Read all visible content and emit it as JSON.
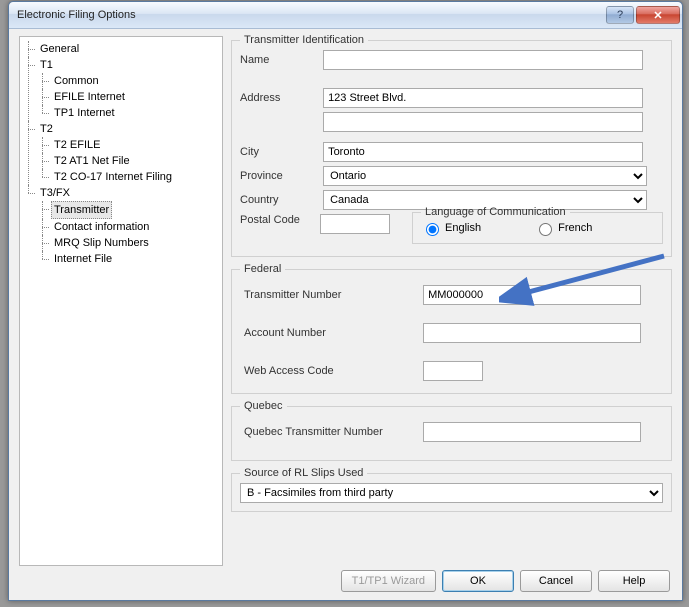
{
  "window": {
    "title": "Electronic Filing Options"
  },
  "tree": {
    "general": "General",
    "t1": "T1",
    "t1_children": {
      "common": "Common",
      "efile": "EFILE Internet",
      "tp1": "TP1 Internet"
    },
    "t2": "T2",
    "t2_children": {
      "efile": "T2 EFILE",
      "at1": "T2 AT1 Net File",
      "co17": "T2 CO-17 Internet Filing"
    },
    "t3fx": "T3/FX",
    "t3fx_children": {
      "transmitter": "Transmitter",
      "contact": "Contact information",
      "mrq": "MRQ Slip Numbers",
      "internet": "Internet File"
    }
  },
  "transmitter": {
    "legend": "Transmitter Identification",
    "name_label": "Name",
    "name": "",
    "address_label": "Address",
    "address1": "123 Street Blvd.",
    "address2": "",
    "city_label": "City",
    "city": "Toronto",
    "province_label": "Province",
    "province": "Ontario",
    "country_label": "Country",
    "country": "Canada",
    "postal_label": "Postal Code",
    "postal": "",
    "lang_legend": "Language of Communication",
    "lang_english": "English",
    "lang_french": "French"
  },
  "federal": {
    "legend": "Federal",
    "transmitter_no_label": "Transmitter Number",
    "transmitter_no": "MM000000",
    "account_no_label": "Account Number",
    "account_no": "",
    "wac_label": "Web Access Code",
    "wac": ""
  },
  "quebec": {
    "legend": "Quebec",
    "transmitter_no_label": "Quebec Transmitter Number",
    "transmitter_no": ""
  },
  "rlslips": {
    "legend": "Source of RL Slips Used",
    "selected": "B - Facsimiles from third party"
  },
  "buttons": {
    "wizard": "T1/TP1 Wizard",
    "ok": "OK",
    "cancel": "Cancel",
    "help": "Help"
  }
}
